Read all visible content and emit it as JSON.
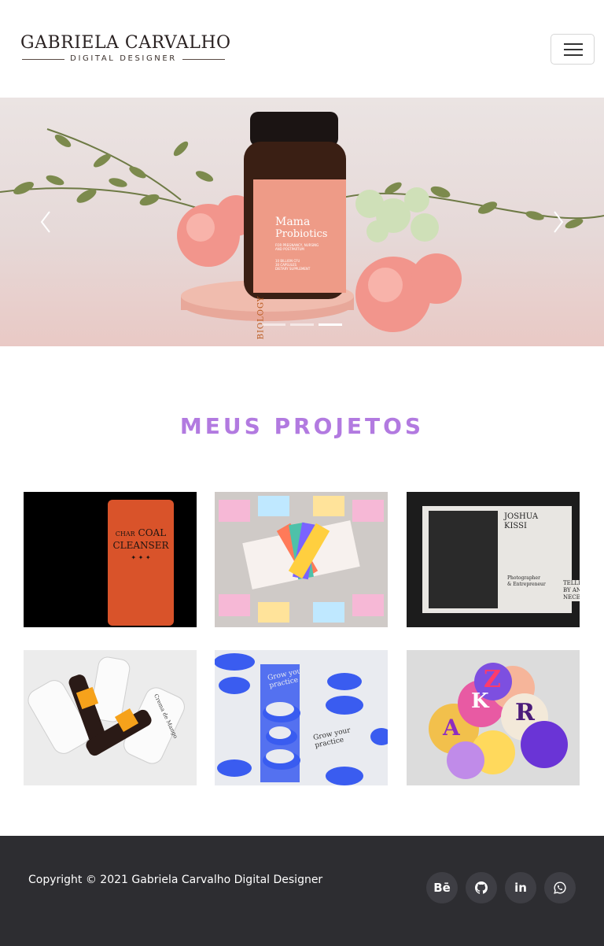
{
  "header": {
    "logo_name": "GABRIELA CARVALHO",
    "logo_subtitle": "DIGITAL DESIGNER",
    "menu_icon": "hamburger-icon"
  },
  "carousel": {
    "slide_count": 3,
    "active_slide": 3,
    "product": {
      "brand": "BIOLOGY",
      "name_line1": "Mama",
      "name_line2": "Probiotics",
      "tag1": "FOR PREGNANCY, NURSING",
      "tag2": "AND POSTPARTUM",
      "spec1": "10 BILLION CFU",
      "spec2": "30 CAPSULES",
      "spec3": "DIETARY SUPPLEMENT"
    },
    "prev_icon": "chevron-left-icon",
    "next_icon": "chevron-right-icon"
  },
  "projects": {
    "title": "MEUS PROJETOS",
    "charcoal": {
      "line1": "CHAR",
      "line2": "COAL",
      "line3": "CLEANSER",
      "stars": "✦ ✦ ✦"
    },
    "joshua": {
      "name1": "JOSHUA",
      "name2": "KISSI",
      "role1": "Photographer",
      "role2": "& Entrepreneur",
      "side1": "TELLI",
      "side2": "BY AN",
      "side3": "NECES"
    },
    "mango": {
      "label": "Crema de Mango"
    },
    "grow": {
      "text1": "Grow your",
      "text2": "practice"
    },
    "letters": {
      "l1": "Z",
      "l2": "R",
      "l3": "A",
      "l4": "K"
    }
  },
  "footer": {
    "copyright": "Copyright © 2021 Gabriela Carvalho Digital Designer",
    "social": [
      {
        "icon": "behance-icon",
        "label": "Bē"
      },
      {
        "icon": "github-icon",
        "label": ""
      },
      {
        "icon": "linkedin-icon",
        "label": "in"
      },
      {
        "icon": "whatsapp-icon",
        "label": ""
      }
    ],
    "colors": {
      "background": "#2d2d31",
      "button": "#3e3e44",
      "accent": "#b27ae0"
    }
  }
}
